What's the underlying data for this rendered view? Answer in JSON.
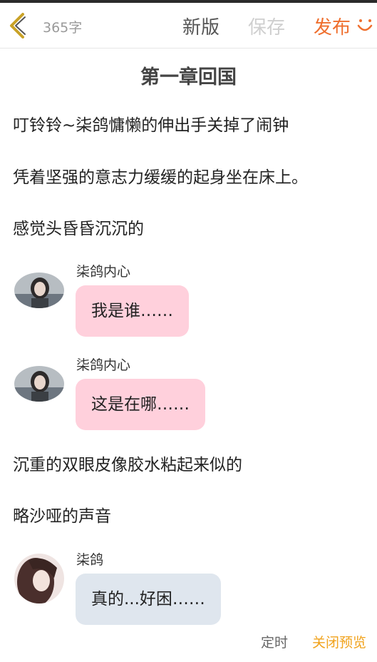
{
  "header": {
    "word_count": "365字",
    "new_version_label": "新版",
    "save_label": "保存",
    "publish_label": "发布",
    "back_icon": "chevron-left-icon",
    "emoji_icon": "smile-icon",
    "colors": {
      "accent": "#ef6f2e",
      "back_icon": "#c9a227",
      "disabled": "#cfcfcf"
    }
  },
  "chapter": {
    "title": "第一章回国"
  },
  "content": {
    "paragraphs_before": [
      "叮铃铃~柒鸽慵懒的伸出手关掉了闹钟",
      "凭着坚强的意志力缓缓的起身坐在床上。",
      "感觉头昏昏沉沉的"
    ],
    "messages_1": [
      {
        "speaker": "柒鸽内心",
        "text": "我是谁……",
        "bubble_color": "#ffd0dc"
      },
      {
        "speaker": "柒鸽内心",
        "text": "这是在哪……",
        "bubble_color": "#ffd0dc"
      }
    ],
    "paragraphs_after": [
      "沉重的双眼皮像胶水粘起来似的",
      "略沙哑的声音"
    ],
    "messages_2": [
      {
        "speaker": "柒鸽",
        "text": "真的...好困……",
        "bubble_color": "#dfe6ee"
      }
    ]
  },
  "footer": {
    "timer_label": "定时",
    "close_preview_label": "关闭预览",
    "colors": {
      "preview": "#f1a21b"
    }
  }
}
